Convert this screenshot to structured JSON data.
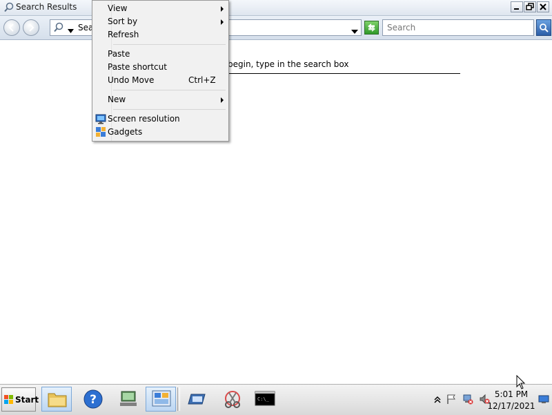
{
  "window": {
    "title": "Search Results"
  },
  "toolbar": {
    "address_text": "Sear",
    "search_placeholder": "Search"
  },
  "main": {
    "instruction": "begin, type in the search box"
  },
  "context_menu": {
    "view": "View",
    "sort_by": "Sort by",
    "refresh": "Refresh",
    "paste": "Paste",
    "paste_shortcut": "Paste shortcut",
    "undo_move": "Undo Move",
    "undo_move_shortcut": "Ctrl+Z",
    "new": "New",
    "screen_resolution": "Screen resolution",
    "gadgets": "Gadgets"
  },
  "taskbar": {
    "start_label": "Start",
    "apps": [
      "file-explorer-icon",
      "help-icon",
      "network-icon",
      "server-manager-icon",
      "tool-icon",
      "snipping-tool-icon",
      "command-prompt-icon"
    ]
  },
  "tray": {
    "time": "5:01 PM",
    "date": "12/17/2021"
  },
  "colors": {
    "accent": "#2c5ea8",
    "menu_bg": "#f1f1f1",
    "taskbar_bg": "#dcdcdc"
  }
}
